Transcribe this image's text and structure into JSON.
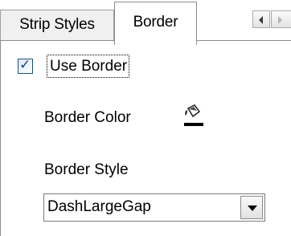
{
  "tabs": [
    {
      "label": "Strip Styles",
      "active": false
    },
    {
      "label": "Border",
      "active": true
    }
  ],
  "tab_scroll": {
    "left_icon": "arrow-left-icon",
    "right_icon": "arrow-right-icon"
  },
  "border": {
    "use_border_label": "Use Border",
    "use_border_checked": true,
    "color_label": "Border Color",
    "color_icon": "paint-bucket-icon",
    "color_value": "#000000",
    "style_label": "Border Style",
    "style_value": "DashLargeGap"
  },
  "colors": {
    "checkmark": "#1f3f8c",
    "tab_inactive_bg": "#f0f0f0",
    "tab_border": "#8c8c8c"
  }
}
